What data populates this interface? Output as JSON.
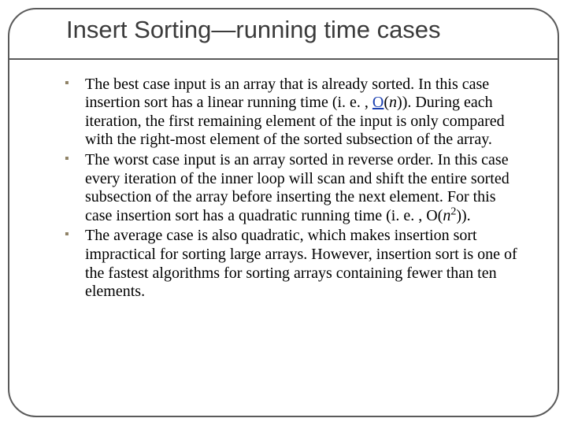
{
  "title": "Insert Sorting—running time cases",
  "bullets": {
    "b1": {
      "pre": "The best case input is an array that is already sorted. In this case insertion sort has a linear running time (i. e. , ",
      "link": "O",
      "mid": "(",
      "n": "n",
      "post": ")). During each iteration, the first remaining element of the input is only compared with the right-most element of the sorted subsection of the array."
    },
    "b2": {
      "pre": "The worst case input is an array sorted in reverse order. In this case every iteration of the inner loop will scan and shift the entire sorted subsection of the array before inserting the next element. For this case insertion sort has a quadratic running time (i. e. , O(",
      "n": "n",
      "exp": "2",
      "post": "))."
    },
    "b3": "The average case is also quadratic, which makes insertion sort impractical for sorting large arrays. However, insertion sort is one of the fastest algorithms for sorting arrays containing fewer than ten elements."
  }
}
